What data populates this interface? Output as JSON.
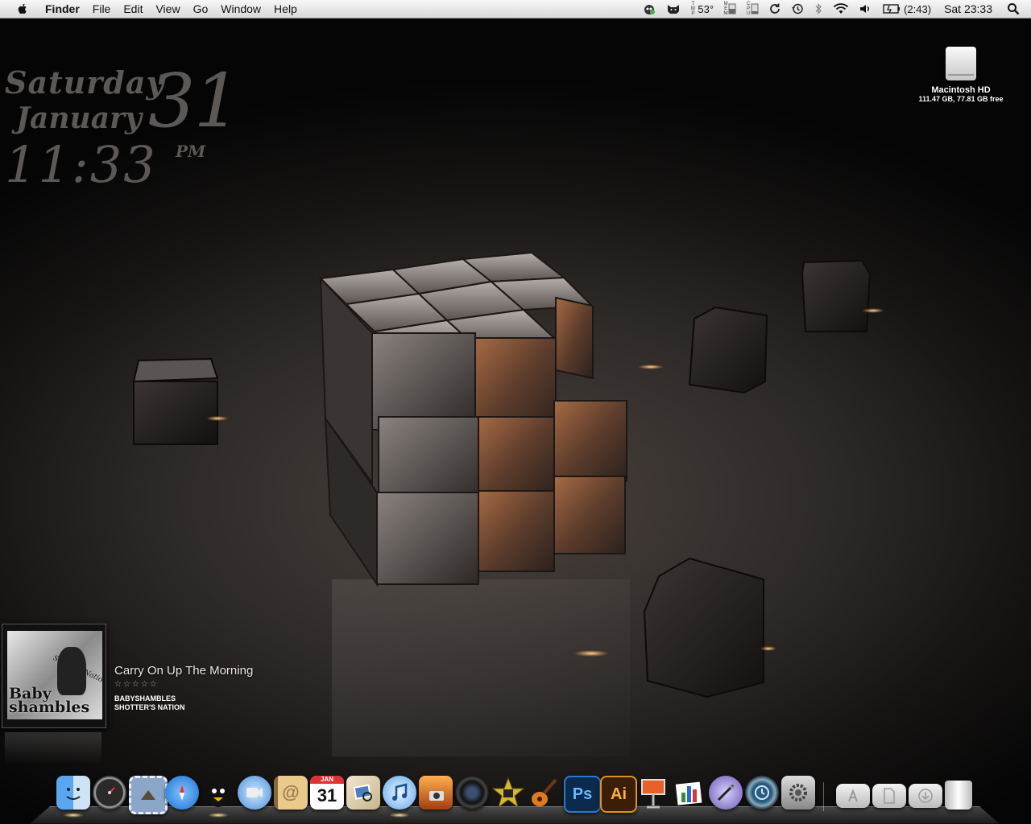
{
  "menubar": {
    "app_name": "Finder",
    "items": [
      "File",
      "Edit",
      "View",
      "Go",
      "Window",
      "Help"
    ],
    "temperature": "53°",
    "temp_label": "TMP",
    "mem_label": "MEM",
    "cpu_label": "CPU",
    "battery_time": "(2:43)",
    "clock": "Sat 23:33"
  },
  "desktop_clock": {
    "day": "Saturday",
    "month": "January",
    "date": "31",
    "time": "11:33",
    "ampm": "PM"
  },
  "drive": {
    "name": "Macintosh HD",
    "info": "111.47 GB, 77.81 GB free"
  },
  "now_playing": {
    "title": "Carry On Up The Morning",
    "rating": "☆☆☆☆☆",
    "artist": "BABYSHAMBLES",
    "album": "SHOTTER'S NATION",
    "cover_text": "Baby shambles",
    "cover_script": "Shotters Nation"
  },
  "dock": {
    "calendar_month": "JAN",
    "calendar_day": "31",
    "ps_label": "Ps",
    "ai_label": "Ai",
    "items": [
      "finder",
      "dashboard",
      "mail-stamp",
      "safari",
      "adium",
      "ichat",
      "address-book",
      "ical",
      "iphoto",
      "itunes",
      "image-capture",
      "camera",
      "imovie",
      "garageband",
      "photoshop",
      "illustrator",
      "keynote",
      "numbers",
      "script-editor",
      "time-machine",
      "system-preferences",
      "applications-folder",
      "documents-folder",
      "downloads-folder",
      "trash"
    ]
  }
}
